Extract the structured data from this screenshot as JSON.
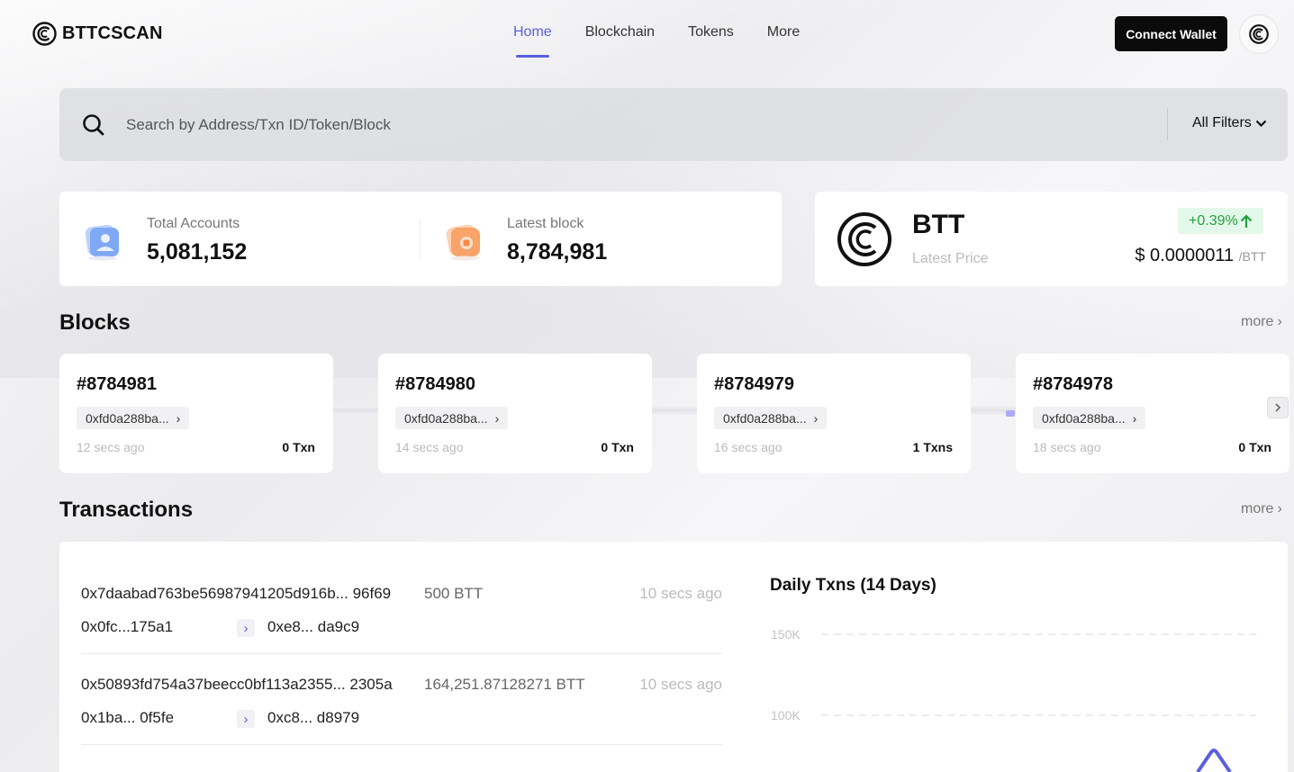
{
  "header": {
    "logo_text": "BTTCSCAN",
    "nav": [
      {
        "label": "Home",
        "active": true
      },
      {
        "label": "Blockchain",
        "active": false
      },
      {
        "label": "Tokens",
        "active": false
      },
      {
        "label": "More",
        "active": false
      }
    ],
    "connect_wallet": "Connect Wallet"
  },
  "search": {
    "placeholder": "Search by Address/Txn ID/Token/Block",
    "filter_label": "All Filters"
  },
  "stats": {
    "total_accounts_label": "Total Accounts",
    "total_accounts_value": "5,081,152",
    "latest_block_label": "Latest block",
    "latest_block_value": "8,784,981"
  },
  "price": {
    "token": "BTT",
    "sub_label": "Latest Price",
    "change": "+0.39%",
    "value": "$ 0.0000011",
    "unit": "/BTT"
  },
  "blocks": {
    "title": "Blocks",
    "more": "more",
    "items": [
      {
        "number": "#8784981",
        "hash": "0xfd0a288ba...",
        "time": "12 secs ago",
        "txns": "0 Txn"
      },
      {
        "number": "#8784980",
        "hash": "0xfd0a288ba...",
        "time": "14 secs ago",
        "txns": "0 Txn"
      },
      {
        "number": "#8784979",
        "hash": "0xfd0a288ba...",
        "time": "16 secs ago",
        "txns": "1 Txns"
      },
      {
        "number": "#8784978",
        "hash": "0xfd0a288ba...",
        "time": "18 secs ago",
        "txns": "0 Txn"
      }
    ]
  },
  "transactions": {
    "title": "Transactions",
    "more": "more",
    "items": [
      {
        "hash": "0x7daabad763be56987941205d916b... 96f69",
        "amount": "500 BTT",
        "time": "10 secs ago",
        "from": "0x0fc...175a1",
        "to": "0xe8... da9c9"
      },
      {
        "hash": "0x50893fd754a37beecc0bf113a2355... 2305a",
        "amount": "164,251.87128271 BTT",
        "time": "10 secs ago",
        "from": "0x1ba... 0f5fe",
        "to": "0xc8... d8979"
      }
    ]
  },
  "chart_data": {
    "type": "line",
    "title": "Daily Txns (14 Days)",
    "y_ticks": [
      "150K",
      "100K"
    ],
    "grid": true,
    "colors": {
      "line": "#5b5fe0"
    }
  },
  "colors": {
    "accent": "#5b5fe0",
    "positive": "#22a13f",
    "positive_bg": "#e4f8e9",
    "dark_button": "#0b0b0b"
  }
}
